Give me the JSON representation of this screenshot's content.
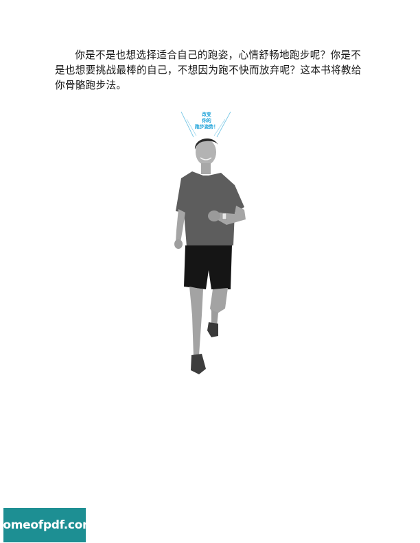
{
  "paragraph": "你是不是也想选择适合自己的跑姿，心情舒畅地跑步呢？你是不是也想要挑战最棒的自己，不想因为跑不快而放弃呢？这本书将教给你骨骼跑步法。",
  "callout": {
    "lines": [
      "改变",
      "你的",
      "跑步姿势！"
    ],
    "color": "#1fa3d9"
  },
  "watermark": {
    "text": "homeofpdf.com",
    "background": "#1d8f93"
  }
}
